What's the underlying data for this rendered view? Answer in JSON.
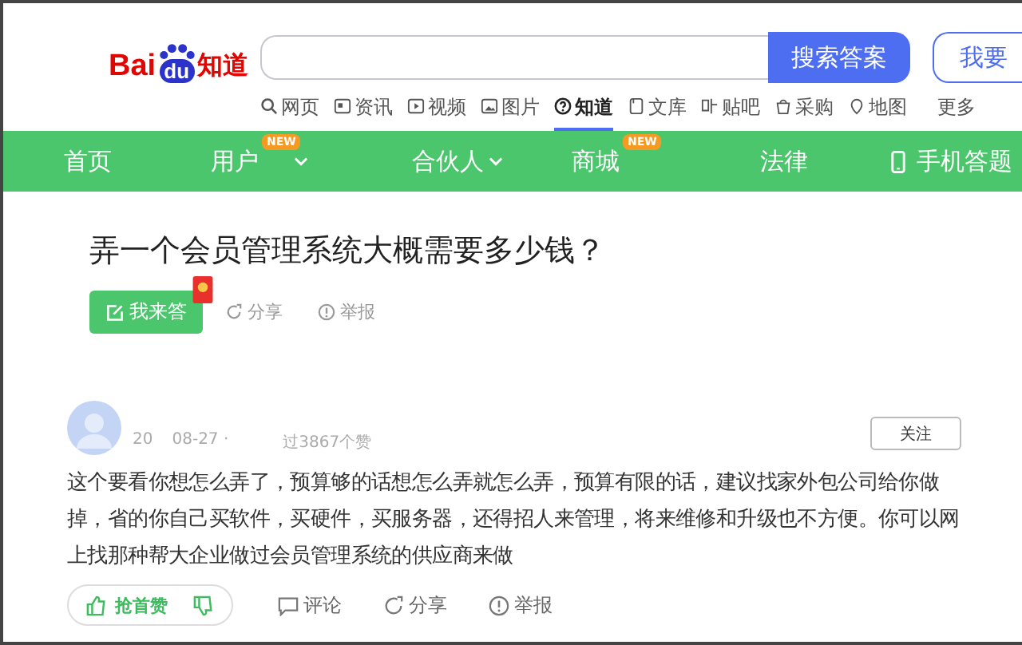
{
  "logo": {
    "part_1": "Bai",
    "part_2": "du",
    "part_3": "知道"
  },
  "search": {
    "button": "搜索答案",
    "ask_button": "我要"
  },
  "channels": [
    {
      "label": "网页",
      "kind": "search",
      "selected": false
    },
    {
      "label": "资讯",
      "kind": "news",
      "selected": false
    },
    {
      "label": "视频",
      "kind": "video",
      "selected": false
    },
    {
      "label": "图片",
      "kind": "image",
      "selected": false
    },
    {
      "label": "知道",
      "kind": "question",
      "selected": true
    },
    {
      "label": "文库",
      "kind": "doc",
      "selected": false
    },
    {
      "label": "贴吧",
      "kind": "forum",
      "selected": false
    },
    {
      "label": "采购",
      "kind": "shop",
      "selected": false
    },
    {
      "label": "地图",
      "kind": "map",
      "selected": false
    },
    {
      "label": "更多",
      "kind": "more",
      "selected": false
    }
  ],
  "nav": [
    {
      "label": "首页",
      "dropdown": false,
      "phone": false
    },
    {
      "label": "用户",
      "badge": "NEW",
      "dropdown": true,
      "phone": false
    },
    {
      "label": "合伙人",
      "dropdown": true,
      "phone": false
    },
    {
      "label": "商城",
      "badge": "NEW",
      "dropdown": false,
      "phone": false
    },
    {
      "label": "法律",
      "dropdown": false,
      "phone": false
    },
    {
      "label": "手机答题",
      "dropdown": false,
      "phone": true
    }
  ],
  "question": {
    "title": "弄一个会员管理系统大概需要多少钱？",
    "answer_button": "我来答",
    "share": "分享",
    "report": "举报"
  },
  "answer": {
    "date_part_1": "20",
    "date_part_2": "08-27 ·",
    "likes": "过3867个赞",
    "follow": "关注",
    "text": "这个要看你想怎么弄了，预算够的话想怎么弄就怎么弄，预算有限的话，建议找家外包公司给你做掉，省的你自己买软件，买硬件，买服务器，还得招人来管理，将来维修和升级也不方便。你可以网上找那种帮大企业做过会员管理系统的供应商来做",
    "like": "抢首赞",
    "comment": "评论",
    "share": "分享",
    "report": "举报"
  }
}
